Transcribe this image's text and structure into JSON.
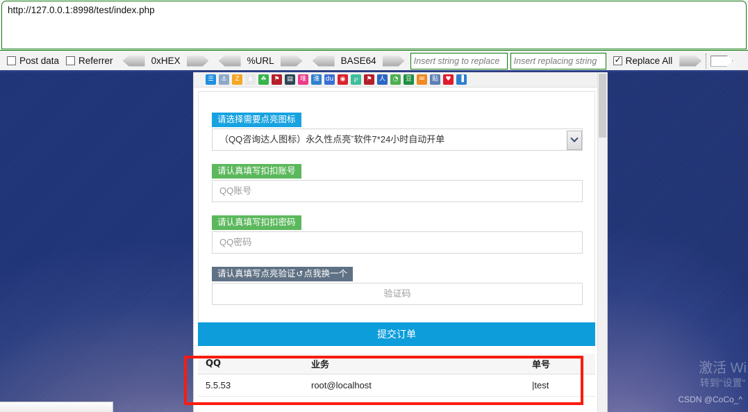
{
  "tool_panel": {
    "url": "http://127.0.0.1:8998/test/index.php",
    "checkboxes": [
      {
        "label": "Post data",
        "checked": false
      },
      {
        "label": "Referrer",
        "checked": false
      }
    ],
    "encoders": [
      {
        "label": "0xHEX"
      },
      {
        "label": "%URL"
      },
      {
        "label": "BASE64"
      }
    ],
    "replace": {
      "find_placeholder": "Insert string to replace",
      "with_placeholder": "Insert replacing string",
      "replace_all_label": "Replace All",
      "replace_all_checked": true
    }
  },
  "browser": {
    "bookmarks": [
      {
        "name": "bookmark-icon-1",
        "color": "#1f8fe0",
        "glyph": "☰"
      },
      {
        "name": "bookmark-icon-2",
        "color": "#8fa8c8",
        "glyph": "⚓"
      },
      {
        "name": "bookmark-icon-3",
        "color": "#f5a623",
        "glyph": "Z"
      },
      {
        "name": "bookmark-icon-4",
        "color": "#e8e8e8",
        "glyph": "♟"
      },
      {
        "name": "bookmark-icon-5",
        "color": "#38b44a",
        "glyph": "☘"
      },
      {
        "name": "bookmark-icon-6",
        "color": "#b51f2a",
        "glyph": "⚑"
      },
      {
        "name": "bookmark-icon-7",
        "color": "#2f4858",
        "glyph": "▤"
      },
      {
        "name": "bookmark-icon-8",
        "color": "#ed3b8a",
        "glyph": "堆"
      },
      {
        "name": "bookmark-icon-9",
        "color": "#2f7fd0",
        "glyph": "淮"
      },
      {
        "name": "bookmark-icon-10",
        "color": "#3b6fd4",
        "glyph": "du"
      },
      {
        "name": "bookmark-icon-11",
        "color": "#d9232e",
        "glyph": "◉"
      },
      {
        "name": "bookmark-icon-12",
        "color": "#3fbf9a",
        "glyph": "℘"
      },
      {
        "name": "bookmark-icon-13",
        "color": "#b51f2a",
        "glyph": "⚑"
      },
      {
        "name": "bookmark-icon-14",
        "color": "#2b67c4",
        "glyph": "人"
      },
      {
        "name": "bookmark-icon-15",
        "color": "#4caf50",
        "glyph": "◔"
      },
      {
        "name": "bookmark-icon-16",
        "color": "#1f8f3f",
        "glyph": "豆"
      },
      {
        "name": "bookmark-icon-17",
        "color": "#f08a24",
        "glyph": "✉"
      },
      {
        "name": "bookmark-icon-18",
        "color": "#5b7fb5",
        "glyph": "贴"
      },
      {
        "name": "bookmark-icon-19",
        "color": "#e01b2e",
        "glyph": "♥"
      },
      {
        "name": "bookmark-icon-20",
        "color": "#2f7fd0",
        "glyph": "▐"
      }
    ]
  },
  "form": {
    "icon_label": "请选择需要点亮图标",
    "icon_select_value": "（QQ咨询达人图标）永久性点亮ˇ软件7*24小时自动开单",
    "account_label": "请认真填写扣扣账号",
    "account_placeholder": "QQ账号",
    "password_label": "请认真填写扣扣密码",
    "password_placeholder": "QQ密码",
    "captcha_label_a": "请认真填写点亮验证",
    "captcha_refresh_icon": "↺",
    "captcha_label_b": "点我换一个",
    "captcha_placeholder": "验证码",
    "submit_label": "提交订单"
  },
  "table": {
    "headers": [
      "QQ",
      "业务",
      "单号"
    ],
    "rows": [
      [
        "5.5.53",
        "root@localhost",
        "|test"
      ]
    ]
  },
  "watermark": {
    "activate_line1": "激活 Wi",
    "activate_line2": "转到\"设置\"",
    "credit": "CSDN @CoCo_^"
  }
}
